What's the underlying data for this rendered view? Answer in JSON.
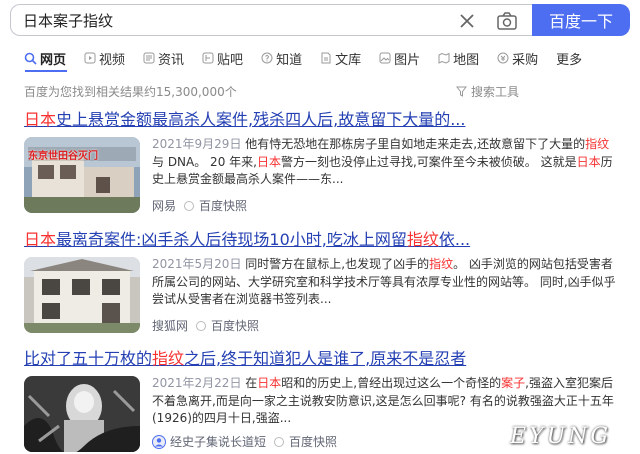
{
  "search": {
    "query": "日本案子指纹",
    "button": "百度一下"
  },
  "tabs": [
    {
      "label": "网页",
      "icon": "search-icon"
    },
    {
      "label": "视频",
      "icon": "video-icon"
    },
    {
      "label": "资讯",
      "icon": "news-icon"
    },
    {
      "label": "贴吧",
      "icon": "tieba-icon"
    },
    {
      "label": "知道",
      "icon": "question-icon"
    },
    {
      "label": "文库",
      "icon": "document-icon"
    },
    {
      "label": "图片",
      "icon": "image-icon"
    },
    {
      "label": "地图",
      "icon": "map-icon"
    },
    {
      "label": "采购",
      "icon": "purchase-icon"
    },
    {
      "label": "更多",
      "icon": ""
    }
  ],
  "result_count": "百度为您找到相关结果约15,300,000个",
  "search_tools": "搜索工具",
  "results": [
    {
      "title_parts": [
        "日本",
        "史上悬赏金额最高杀人案件,残杀四人后,故意留下大量的..."
      ],
      "date": "2021年9月29日",
      "snippet": [
        {
          "t": " 他有恃无恐地在那栋房子里自如地走来走去,还故意留下了大量的",
          "h": false
        },
        {
          "t": "指纹",
          "h": true
        },
        {
          "t": "与 DNA。 20 年来,",
          "h": false
        },
        {
          "t": "日本",
          "h": true
        },
        {
          "t": "警方一刻也没停止过寻找,可案件至今未被侦破。 这就是",
          "h": false
        },
        {
          "t": "日本",
          "h": true
        },
        {
          "t": "历史上悬赏金额最高杀人案件——东...",
          "h": false
        }
      ],
      "source": "网易",
      "kuaizhao": "百度快照",
      "thumb_text": "东京世田谷灭门"
    },
    {
      "title_parts": [
        "日本",
        "最离奇案件:凶手杀人后待现场10小时,吃冰上网留",
        "指纹",
        "依..."
      ],
      "date": "2021年5月20日",
      "snippet": [
        {
          "t": " 同时警方在鼠标上,也发现了凶手的",
          "h": false
        },
        {
          "t": "指纹",
          "h": true
        },
        {
          "t": "。 凶手浏览的网站包括受害者所属公司的网站、大学研究室和科学技术厅等具有浓厚专业性的网站等。 同时,凶手似乎尝试从受害者在浏览器书签列表...",
          "h": false
        }
      ],
      "source": "搜狐网",
      "kuaizhao": "百度快照"
    },
    {
      "title_parts": [
        "比对了五十万枚的",
        "指纹",
        "之后,终于知道犯人是谁了,原来不是忍者"
      ],
      "date": "2021年2月22日",
      "snippet": [
        {
          "t": " 在",
          "h": false
        },
        {
          "t": "日本",
          "h": true
        },
        {
          "t": "昭和的历史上,曾经出现过这么一个奇怪的",
          "h": false
        },
        {
          "t": "案子",
          "h": true
        },
        {
          "t": ",强盗入室犯案后不着急离开,而是向一家之主说教安防意识,这是怎么回事呢? 有名的说教强盗大正十五年(1926)的四月十日,强盗...",
          "h": false
        }
      ],
      "source": "经史子集说长道短",
      "kuaizhao": "百度快照"
    }
  ],
  "watermark": "EYUNG",
  "colors": {
    "accent": "#4e6ef2",
    "link": "#2440b3",
    "highlight": "#f73131"
  }
}
